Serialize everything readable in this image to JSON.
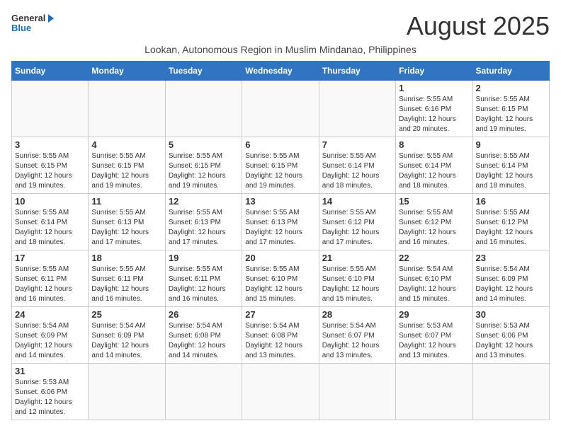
{
  "header": {
    "logo_general": "General",
    "logo_blue": "Blue",
    "month_title": "August 2025",
    "subtitle": "Lookan, Autonomous Region in Muslim Mindanao, Philippines"
  },
  "days_of_week": [
    "Sunday",
    "Monday",
    "Tuesday",
    "Wednesday",
    "Thursday",
    "Friday",
    "Saturday"
  ],
  "weeks": [
    [
      {
        "day": "",
        "info": ""
      },
      {
        "day": "",
        "info": ""
      },
      {
        "day": "",
        "info": ""
      },
      {
        "day": "",
        "info": ""
      },
      {
        "day": "",
        "info": ""
      },
      {
        "day": "1",
        "info": "Sunrise: 5:55 AM\nSunset: 6:16 PM\nDaylight: 12 hours and 20 minutes."
      },
      {
        "day": "2",
        "info": "Sunrise: 5:55 AM\nSunset: 6:15 PM\nDaylight: 12 hours and 19 minutes."
      }
    ],
    [
      {
        "day": "3",
        "info": "Sunrise: 5:55 AM\nSunset: 6:15 PM\nDaylight: 12 hours and 19 minutes."
      },
      {
        "day": "4",
        "info": "Sunrise: 5:55 AM\nSunset: 6:15 PM\nDaylight: 12 hours and 19 minutes."
      },
      {
        "day": "5",
        "info": "Sunrise: 5:55 AM\nSunset: 6:15 PM\nDaylight: 12 hours and 19 minutes."
      },
      {
        "day": "6",
        "info": "Sunrise: 5:55 AM\nSunset: 6:15 PM\nDaylight: 12 hours and 19 minutes."
      },
      {
        "day": "7",
        "info": "Sunrise: 5:55 AM\nSunset: 6:14 PM\nDaylight: 12 hours and 18 minutes."
      },
      {
        "day": "8",
        "info": "Sunrise: 5:55 AM\nSunset: 6:14 PM\nDaylight: 12 hours and 18 minutes."
      },
      {
        "day": "9",
        "info": "Sunrise: 5:55 AM\nSunset: 6:14 PM\nDaylight: 12 hours and 18 minutes."
      }
    ],
    [
      {
        "day": "10",
        "info": "Sunrise: 5:55 AM\nSunset: 6:14 PM\nDaylight: 12 hours and 18 minutes."
      },
      {
        "day": "11",
        "info": "Sunrise: 5:55 AM\nSunset: 6:13 PM\nDaylight: 12 hours and 17 minutes."
      },
      {
        "day": "12",
        "info": "Sunrise: 5:55 AM\nSunset: 6:13 PM\nDaylight: 12 hours and 17 minutes."
      },
      {
        "day": "13",
        "info": "Sunrise: 5:55 AM\nSunset: 6:13 PM\nDaylight: 12 hours and 17 minutes."
      },
      {
        "day": "14",
        "info": "Sunrise: 5:55 AM\nSunset: 6:12 PM\nDaylight: 12 hours and 17 minutes."
      },
      {
        "day": "15",
        "info": "Sunrise: 5:55 AM\nSunset: 6:12 PM\nDaylight: 12 hours and 16 minutes."
      },
      {
        "day": "16",
        "info": "Sunrise: 5:55 AM\nSunset: 6:12 PM\nDaylight: 12 hours and 16 minutes."
      }
    ],
    [
      {
        "day": "17",
        "info": "Sunrise: 5:55 AM\nSunset: 6:11 PM\nDaylight: 12 hours and 16 minutes."
      },
      {
        "day": "18",
        "info": "Sunrise: 5:55 AM\nSunset: 6:11 PM\nDaylight: 12 hours and 16 minutes."
      },
      {
        "day": "19",
        "info": "Sunrise: 5:55 AM\nSunset: 6:11 PM\nDaylight: 12 hours and 16 minutes."
      },
      {
        "day": "20",
        "info": "Sunrise: 5:55 AM\nSunset: 6:10 PM\nDaylight: 12 hours and 15 minutes."
      },
      {
        "day": "21",
        "info": "Sunrise: 5:55 AM\nSunset: 6:10 PM\nDaylight: 12 hours and 15 minutes."
      },
      {
        "day": "22",
        "info": "Sunrise: 5:54 AM\nSunset: 6:10 PM\nDaylight: 12 hours and 15 minutes."
      },
      {
        "day": "23",
        "info": "Sunrise: 5:54 AM\nSunset: 6:09 PM\nDaylight: 12 hours and 14 minutes."
      }
    ],
    [
      {
        "day": "24",
        "info": "Sunrise: 5:54 AM\nSunset: 6:09 PM\nDaylight: 12 hours and 14 minutes."
      },
      {
        "day": "25",
        "info": "Sunrise: 5:54 AM\nSunset: 6:09 PM\nDaylight: 12 hours and 14 minutes."
      },
      {
        "day": "26",
        "info": "Sunrise: 5:54 AM\nSunset: 6:08 PM\nDaylight: 12 hours and 14 minutes."
      },
      {
        "day": "27",
        "info": "Sunrise: 5:54 AM\nSunset: 6:08 PM\nDaylight: 12 hours and 13 minutes."
      },
      {
        "day": "28",
        "info": "Sunrise: 5:54 AM\nSunset: 6:07 PM\nDaylight: 12 hours and 13 minutes."
      },
      {
        "day": "29",
        "info": "Sunrise: 5:53 AM\nSunset: 6:07 PM\nDaylight: 12 hours and 13 minutes."
      },
      {
        "day": "30",
        "info": "Sunrise: 5:53 AM\nSunset: 6:06 PM\nDaylight: 12 hours and 13 minutes."
      }
    ],
    [
      {
        "day": "31",
        "info": "Sunrise: 5:53 AM\nSunset: 6:06 PM\nDaylight: 12 hours and 12 minutes."
      },
      {
        "day": "",
        "info": ""
      },
      {
        "day": "",
        "info": ""
      },
      {
        "day": "",
        "info": ""
      },
      {
        "day": "",
        "info": ""
      },
      {
        "day": "",
        "info": ""
      },
      {
        "day": "",
        "info": ""
      }
    ]
  ]
}
